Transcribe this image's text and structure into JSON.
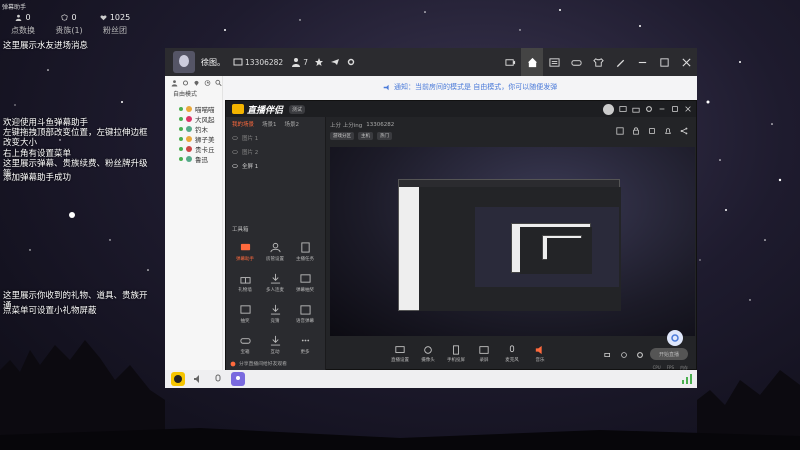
{
  "helper": {
    "title": "弹幕助手",
    "stats": [
      {
        "value": "0",
        "label": "点数换",
        "icon": "person-icon"
      },
      {
        "value": "0",
        "label": "贵族(1)",
        "icon": "badge-icon"
      },
      {
        "value": "1025",
        "label": "粉丝团",
        "icon": "fans-icon"
      }
    ]
  },
  "overlay": {
    "water_friends": "这里展示水友进场消息",
    "usage_lines": [
      "欢迎使用斗鱼弹幕助手",
      "左键拖拽顶部改变位置，左键拉伸边框改变大小",
      "右上角有设置菜单",
      "这里展示弹幕、贵族续费、粉丝牌升级等",
      "添加弹幕助手成功"
    ],
    "gift_lines": [
      "这里展示你收到的礼物、道具、贵族开通",
      "点菜单可设置小礼物屏蔽"
    ]
  },
  "app": {
    "user_name": "徐图。",
    "room_id": "13306282",
    "fans": "7",
    "mode": "自由模式",
    "notice": "通知：当前房间的模式是 自由模式，你可以随便发弹",
    "user_list": [
      "喵喵喵",
      "大风起",
      "钓木",
      "狮子美",
      "贵卡丘",
      "鲁迅"
    ],
    "top_icons": [
      "broadcast-icon",
      "home-icon",
      "list-icon",
      "gamepad-icon",
      "shirt-icon",
      "minimize-icon",
      "maximize-icon",
      "close-icon"
    ]
  },
  "studio": {
    "logo": "直播伴侣",
    "version": "测试",
    "scene_tabs": [
      "我的场景",
      "场景1",
      "场景2"
    ],
    "scenes": [
      "图片 1",
      "图片 2",
      "全屏 1"
    ],
    "tools_label": "工具箱",
    "tools": [
      {
        "label": "弹幕助手",
        "active": true
      },
      {
        "label": "房管设置",
        "active": false
      },
      {
        "label": "主播任务",
        "active": false
      },
      {
        "label": "礼物墙",
        "active": false
      },
      {
        "label": "多人连麦",
        "active": false
      },
      {
        "label": "弹幕抽奖",
        "active": false
      },
      {
        "label": "抽奖",
        "active": false
      },
      {
        "label": "竞猜",
        "active": false
      },
      {
        "label": "语音弹幕",
        "active": false
      },
      {
        "label": "宝箱",
        "active": false
      },
      {
        "label": "互动",
        "active": false
      },
      {
        "label": "更多",
        "active": false
      }
    ],
    "footer_note": "分享直播间给好友观看",
    "info_title": "上分 上分ing",
    "info_id": "13306282",
    "info_chips": [
      "游戏分区",
      "主机",
      "热门"
    ],
    "toolbar": [
      "直播设置",
      "摄像头",
      "手机投屏",
      "录屏",
      "麦克风",
      "音乐"
    ],
    "go_live": "开始直播",
    "status": [
      "CPU",
      "FPS",
      "内存"
    ]
  }
}
